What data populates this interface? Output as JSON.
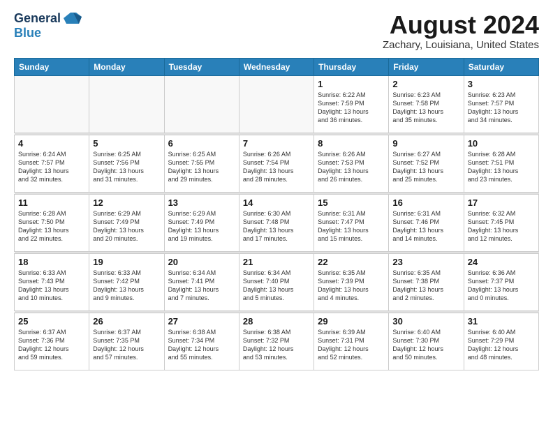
{
  "header": {
    "logo_general": "General",
    "logo_blue": "Blue",
    "title": "August 2024",
    "subtitle": "Zachary, Louisiana, United States"
  },
  "calendar": {
    "days_of_week": [
      "Sunday",
      "Monday",
      "Tuesday",
      "Wednesday",
      "Thursday",
      "Friday",
      "Saturday"
    ],
    "weeks": [
      {
        "days": [
          {
            "number": "",
            "info": ""
          },
          {
            "number": "",
            "info": ""
          },
          {
            "number": "",
            "info": ""
          },
          {
            "number": "",
            "info": ""
          },
          {
            "number": "1",
            "info": "Sunrise: 6:22 AM\nSunset: 7:59 PM\nDaylight: 13 hours\nand 36 minutes."
          },
          {
            "number": "2",
            "info": "Sunrise: 6:23 AM\nSunset: 7:58 PM\nDaylight: 13 hours\nand 35 minutes."
          },
          {
            "number": "3",
            "info": "Sunrise: 6:23 AM\nSunset: 7:57 PM\nDaylight: 13 hours\nand 34 minutes."
          }
        ]
      },
      {
        "days": [
          {
            "number": "4",
            "info": "Sunrise: 6:24 AM\nSunset: 7:57 PM\nDaylight: 13 hours\nand 32 minutes."
          },
          {
            "number": "5",
            "info": "Sunrise: 6:25 AM\nSunset: 7:56 PM\nDaylight: 13 hours\nand 31 minutes."
          },
          {
            "number": "6",
            "info": "Sunrise: 6:25 AM\nSunset: 7:55 PM\nDaylight: 13 hours\nand 29 minutes."
          },
          {
            "number": "7",
            "info": "Sunrise: 6:26 AM\nSunset: 7:54 PM\nDaylight: 13 hours\nand 28 minutes."
          },
          {
            "number": "8",
            "info": "Sunrise: 6:26 AM\nSunset: 7:53 PM\nDaylight: 13 hours\nand 26 minutes."
          },
          {
            "number": "9",
            "info": "Sunrise: 6:27 AM\nSunset: 7:52 PM\nDaylight: 13 hours\nand 25 minutes."
          },
          {
            "number": "10",
            "info": "Sunrise: 6:28 AM\nSunset: 7:51 PM\nDaylight: 13 hours\nand 23 minutes."
          }
        ]
      },
      {
        "days": [
          {
            "number": "11",
            "info": "Sunrise: 6:28 AM\nSunset: 7:50 PM\nDaylight: 13 hours\nand 22 minutes."
          },
          {
            "number": "12",
            "info": "Sunrise: 6:29 AM\nSunset: 7:49 PM\nDaylight: 13 hours\nand 20 minutes."
          },
          {
            "number": "13",
            "info": "Sunrise: 6:29 AM\nSunset: 7:49 PM\nDaylight: 13 hours\nand 19 minutes."
          },
          {
            "number": "14",
            "info": "Sunrise: 6:30 AM\nSunset: 7:48 PM\nDaylight: 13 hours\nand 17 minutes."
          },
          {
            "number": "15",
            "info": "Sunrise: 6:31 AM\nSunset: 7:47 PM\nDaylight: 13 hours\nand 15 minutes."
          },
          {
            "number": "16",
            "info": "Sunrise: 6:31 AM\nSunset: 7:46 PM\nDaylight: 13 hours\nand 14 minutes."
          },
          {
            "number": "17",
            "info": "Sunrise: 6:32 AM\nSunset: 7:45 PM\nDaylight: 13 hours\nand 12 minutes."
          }
        ]
      },
      {
        "days": [
          {
            "number": "18",
            "info": "Sunrise: 6:33 AM\nSunset: 7:43 PM\nDaylight: 13 hours\nand 10 minutes."
          },
          {
            "number": "19",
            "info": "Sunrise: 6:33 AM\nSunset: 7:42 PM\nDaylight: 13 hours\nand 9 minutes."
          },
          {
            "number": "20",
            "info": "Sunrise: 6:34 AM\nSunset: 7:41 PM\nDaylight: 13 hours\nand 7 minutes."
          },
          {
            "number": "21",
            "info": "Sunrise: 6:34 AM\nSunset: 7:40 PM\nDaylight: 13 hours\nand 5 minutes."
          },
          {
            "number": "22",
            "info": "Sunrise: 6:35 AM\nSunset: 7:39 PM\nDaylight: 13 hours\nand 4 minutes."
          },
          {
            "number": "23",
            "info": "Sunrise: 6:35 AM\nSunset: 7:38 PM\nDaylight: 13 hours\nand 2 minutes."
          },
          {
            "number": "24",
            "info": "Sunrise: 6:36 AM\nSunset: 7:37 PM\nDaylight: 13 hours\nand 0 minutes."
          }
        ]
      },
      {
        "days": [
          {
            "number": "25",
            "info": "Sunrise: 6:37 AM\nSunset: 7:36 PM\nDaylight: 12 hours\nand 59 minutes."
          },
          {
            "number": "26",
            "info": "Sunrise: 6:37 AM\nSunset: 7:35 PM\nDaylight: 12 hours\nand 57 minutes."
          },
          {
            "number": "27",
            "info": "Sunrise: 6:38 AM\nSunset: 7:34 PM\nDaylight: 12 hours\nand 55 minutes."
          },
          {
            "number": "28",
            "info": "Sunrise: 6:38 AM\nSunset: 7:32 PM\nDaylight: 12 hours\nand 53 minutes."
          },
          {
            "number": "29",
            "info": "Sunrise: 6:39 AM\nSunset: 7:31 PM\nDaylight: 12 hours\nand 52 minutes."
          },
          {
            "number": "30",
            "info": "Sunrise: 6:40 AM\nSunset: 7:30 PM\nDaylight: 12 hours\nand 50 minutes."
          },
          {
            "number": "31",
            "info": "Sunrise: 6:40 AM\nSunset: 7:29 PM\nDaylight: 12 hours\nand 48 minutes."
          }
        ]
      }
    ]
  }
}
